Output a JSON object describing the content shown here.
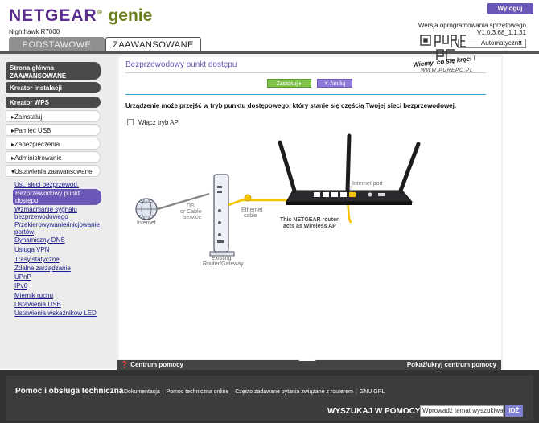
{
  "header": {
    "brand": "NETGEAR",
    "product": "genie",
    "trademark": "®",
    "model": "Nighthawk R7000",
    "logout_label": "Wyloguj",
    "firmware_title": "Wersja oprogramowania sprzętowego",
    "firmware_version": "V1.0.3.68_1.1.31",
    "language_value": "Automatyczna",
    "tabs": {
      "basic": "PODSTAWOWE",
      "advanced": "ZAAWANSOWANE"
    }
  },
  "watermark": {
    "logo_text": "PURE PC",
    "slogan": "Wiemy, co się kręci !",
    "url": "WWW.PUREPC.PL"
  },
  "sidebar": {
    "home": "Strona główna ZAAWANSOWANE",
    "setup_wizard": "Kreator instalacji",
    "wps_wizard": "Kreator WPS",
    "sections": [
      {
        "label": "Zainstaluj",
        "expanded": false
      },
      {
        "label": "Pamięć USB",
        "expanded": false
      },
      {
        "label": "Zabezpieczenia",
        "expanded": false
      },
      {
        "label": "Administrowanie",
        "expanded": false
      },
      {
        "label": "Ustawienia zaawansowane",
        "expanded": true
      }
    ],
    "sub_items": [
      "Ust. sieci bezprzewod.",
      "Bezprzewodowy punkt dostępu",
      "Wzmacnianie sygnału bezprzewodowego",
      "Przekierowywanie/inicjowanie portów",
      "Dynamiczny DNS",
      "Usługa VPN",
      "Trasy statyczne",
      "Zdalne zarządzanie",
      "UPnP",
      "IPv6",
      "Miernik ruchu",
      "Ustawienia USB",
      "Ustawienia wskaźników LED"
    ],
    "active_sub_item": "Bezprzewodowy punkt dostępu"
  },
  "main": {
    "title": "Bezprzewodowy punkt dostępu",
    "apply_label": "Zastosuj ▸",
    "cancel_label": "✕ Anuluj",
    "description": "Urządzenie może przejść w tryb punktu dostępowego, który stanie się częścią Twojej sieci bezprzewodowej.",
    "checkbox_label": "Włącz tryb AP",
    "checkbox_checked": false,
    "diagram": {
      "internet": "Internet",
      "dsl": [
        "DSL",
        "or Cable",
        "service"
      ],
      "ethernet": [
        "Ethernet",
        "cable"
      ],
      "gateway": [
        "Existing",
        "Router/Gateway"
      ],
      "internet_port": "Internet port",
      "ap_note": [
        "This NETGEAR router",
        "acts as Wireless AP"
      ]
    }
  },
  "help_bar": {
    "center": "Centrum pomocy",
    "toggle": "Pokaż/ukryj centrum pomocy"
  },
  "footer": {
    "support_title": "Pomoc i obsługa techniczna",
    "links": [
      "Dokumentacja",
      "Pomoc techniczna online",
      "Często zadawane pytania związane z routerem",
      "GNU GPL"
    ],
    "search_title": "WYSZUKAJ W POMOCY",
    "search_placeholder": "Wprowadź temat wyszukiwa",
    "search_button": "IDŹ"
  },
  "colors": {
    "brand_purple": "#5a2f8e",
    "genie_green": "#6a7d1c",
    "accent_purple": "#6b57b8",
    "apply_green": "#7fc34a",
    "cable_yellow": "#f5c400",
    "separator_blue": "#3aa0d8"
  }
}
